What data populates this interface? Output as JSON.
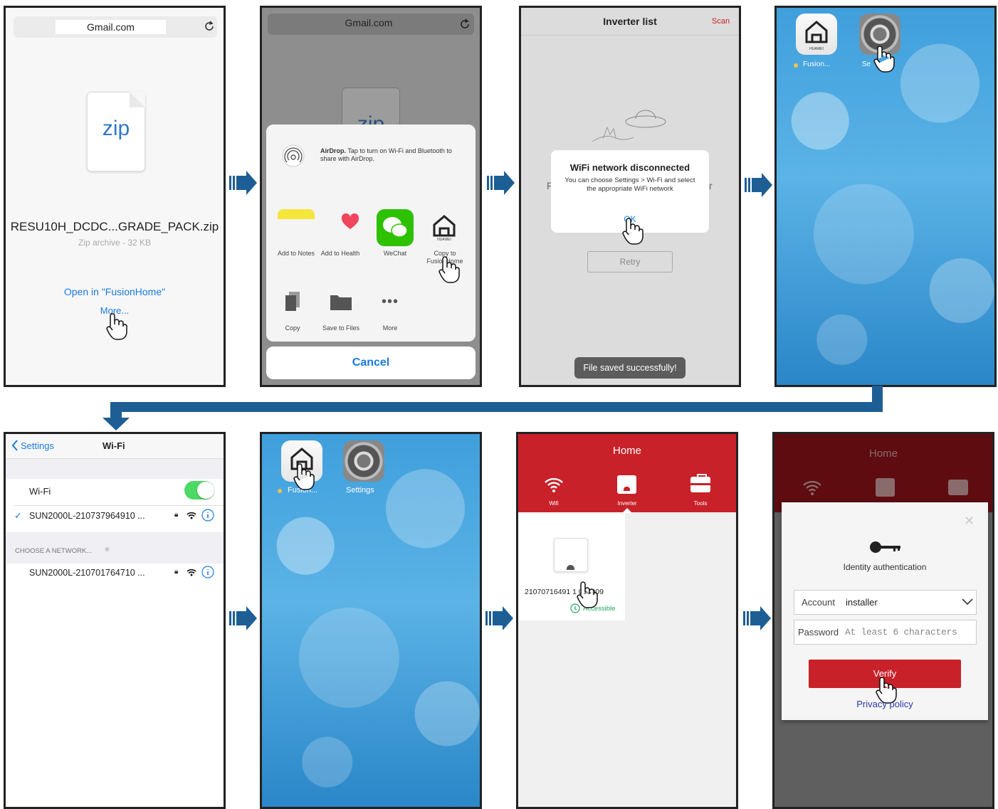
{
  "panel1": {
    "url": "Gmail.com",
    "file_ext": "zip",
    "file_name": "RESU10H_DCDC...GRADE_PACK.zip",
    "file_meta": "Zip archive - 32 KB",
    "open_in": "Open in \"FusionHome\"",
    "more": "More..."
  },
  "panel2": {
    "url": "Gmail.com",
    "file_ext": "zip",
    "airdrop_bold": "AirDrop.",
    "airdrop_text": " Tap to turn on Wi-Fi and Bluetooth to share with AirDrop.",
    "apps": [
      "Add to Notes",
      "Add to Health",
      "WeChat",
      "Copy to FusionHome"
    ],
    "huawei": "HUAWEI",
    "actions": [
      "Copy",
      "Save to Files",
      "More"
    ],
    "cancel": "Cancel"
  },
  "panel3": {
    "title": "Inverter list",
    "scan": "Scan",
    "bg_left": "F",
    "bg_right": "r",
    "dialog_title": "WiFi network disconnected",
    "dialog_text": "You can choose Settings > Wi-Fi and select the appropriate WiFi network",
    "ok": "OK",
    "retry": "Retry",
    "toast": "File saved successfully!"
  },
  "panel4": {
    "huawei": "HUAWEI",
    "fusion_label": "Fusion...",
    "settings_label": "Se   s"
  },
  "panel5": {
    "back": "Settings",
    "title": "Wi-Fi",
    "wifi_label": "Wi-Fi",
    "connected": "SUN2000L-210737964910 ...",
    "choose": "CHOOSE A NETWORK...",
    "other": "SUN2000L-210701764710 ..."
  },
  "panel6": {
    "fusion_label": "Fusion...",
    "settings_label": "Settings"
  },
  "panel7": {
    "title": "Home",
    "tabs": [
      "Wifi",
      "Inverter",
      "Tools"
    ],
    "serial": "21070716491 1 000009",
    "status": "Accessible"
  },
  "panel8": {
    "title": "Home",
    "auth": "Identity authentication",
    "account_label": "Account",
    "account_value": "installer",
    "password_label": "Password",
    "password_placeholder": "At least 6 characters",
    "verify": "Verify",
    "privacy": "Privacy policy"
  },
  "colors": {
    "ios_blue": "#1a7ae0",
    "huawei_red": "#c8212a",
    "dark_red": "#5e0c10",
    "connector": "#1d5e95",
    "toggle_green": "#4cd964",
    "accessible_green": "#1ca65c"
  }
}
